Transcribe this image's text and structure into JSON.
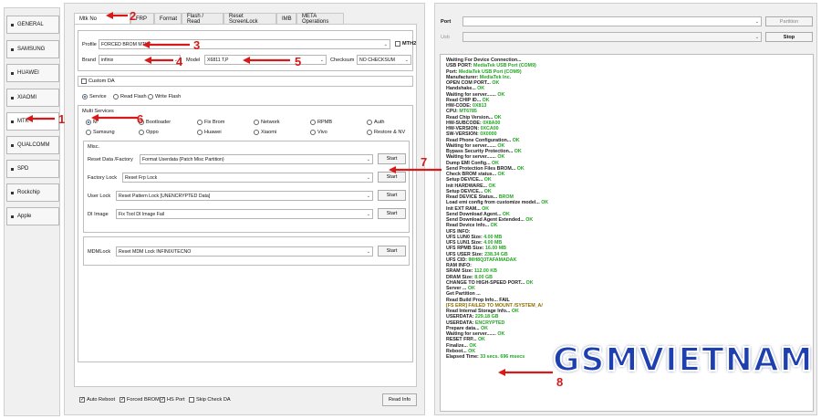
{
  "sidebar": {
    "items": [
      "GENERAL",
      "SAMSUNG",
      "HUAWEI",
      "XIAOMI",
      "MTK",
      "QUALCOMM",
      "SPD",
      "Rockchip",
      "Apple"
    ]
  },
  "tabs": [
    "Mtk No",
    "FRP",
    "Format",
    "Flash / Read",
    "Reset ScreenLock",
    "IMB",
    "META Operations"
  ],
  "top": {
    "profile_label": "Profile",
    "profile_value": "FORCED BROM MTH2",
    "mth2_label": "MTH2",
    "brand_label": "Brand",
    "brand_value": "infinix",
    "model_label": "Model",
    "model_value": "X6811 T,P",
    "checksum_label": "Checksum",
    "checksum_value": "NO CHECKSUM",
    "custom_da_label": "Custom DA"
  },
  "modes": [
    "Service",
    "Read Flash",
    "Write Flash"
  ],
  "multi_services": {
    "title": "Multi Services",
    "row1": [
      "M",
      "Bootloader",
      "Fix Brom",
      "Network",
      "RPMB",
      "Auth"
    ],
    "row2": [
      "Samsung",
      "Oppo",
      "Huawei",
      "Xiaomi",
      "Vivo",
      "Restore & NV"
    ]
  },
  "misc": {
    "title": "Misc.",
    "rows": [
      {
        "label": "Reset Data /Factory",
        "value": "Format Userdata (Patch Misc Partition)",
        "button": "Start"
      },
      {
        "label": "Factory Lock",
        "value": "Reset Frp Lock",
        "button": "Start"
      },
      {
        "label": "User Lock",
        "value": "Reset Pattern Lock [UNENCRYPTED Data]",
        "button": "Start"
      },
      {
        "label": "DI Image",
        "value": "Fix Tool DI Image Fail",
        "button": "Start"
      }
    ],
    "mdm_label": "MDMLock",
    "mdm_value": "Reset MDM Lock INFINIX/TECNO",
    "mdm_button": "Start"
  },
  "bottom": {
    "checks": [
      "Auto Reboot",
      "Forced BROM",
      "HS Port",
      "Skip Check DA"
    ],
    "read_info": "Read Info"
  },
  "right": {
    "port_label": "Port",
    "partition_button": "Partition",
    "usb_label": "Usb",
    "stop_button": "Stop"
  },
  "log": [
    {
      "k": "Waiting For Device Connection...",
      "v": ""
    },
    {
      "k": "USB PORT: ",
      "v": "MediaTek USB Port (COM9)"
    },
    {
      "k": "Port: ",
      "v": "MediaTek USB Port (COM9)"
    },
    {
      "k": "Manufacturer: ",
      "v": "MediaTek Inc."
    },
    {
      "k": "OPEN COM PORT... ",
      "v": "OK"
    },
    {
      "k": "Handshake... ",
      "v": "OK"
    },
    {
      "k": "Waiting for server....... ",
      "v": "OK"
    },
    {
      "k": "Read CHIP ID... ",
      "v": "OK"
    },
    {
      "k": "HW-CODE: ",
      "v": "0X813"
    },
    {
      "k": "CPU: ",
      "v": "MT6785"
    },
    {
      "k": "Read Chip Version... ",
      "v": "OK"
    },
    {
      "k": "HW-SUBCODE: ",
      "v": "0X8A00"
    },
    {
      "k": "HW-VERSION: ",
      "v": "0XCA00"
    },
    {
      "k": "SW-VERSION: ",
      "v": "0X0000"
    },
    {
      "k": "Read Phone Configuration... ",
      "v": "OK"
    },
    {
      "k": "Waiting for server....... ",
      "v": "OK"
    },
    {
      "k": "Bypass Security Protection... ",
      "v": "OK"
    },
    {
      "k": "Waiting for server....... ",
      "v": "OK"
    },
    {
      "k": "Dump EMI Config... ",
      "v": "OK"
    },
    {
      "k": "Send Protection Files BROM... ",
      "v": "OK"
    },
    {
      "k": "Check BROM status... ",
      "v": "OK"
    },
    {
      "k": "Setup DEVICE... ",
      "v": "OK"
    },
    {
      "k": "Init HARDWARE... ",
      "v": "OK"
    },
    {
      "k": "Setup DEVICE... ",
      "v": "OK"
    },
    {
      "k": "Read DEVICE Status... ",
      "v": "BROM"
    },
    {
      "k": "Load emi config from customize model... ",
      "v": "OK"
    },
    {
      "k": "Init EXT RAM... ",
      "v": "OK"
    },
    {
      "k": "Send Download Agent... ",
      "v": "OK"
    },
    {
      "k": "Send Download Agent Extended... ",
      "v": "OK"
    },
    {
      "k": "Read Device Info... ",
      "v": "OK"
    },
    {
      "k": "UFS INFO:",
      "v": ""
    },
    {
      "k": "UFS LUN0 Size: ",
      "v": "4.00 MB"
    },
    {
      "k": "UFS LUN1 Size: ",
      "v": "4.00 MB"
    },
    {
      "k": "UFS RPMB Size: ",
      "v": "16.00 MB"
    },
    {
      "k": "UFS USER Size: ",
      "v": "238.34 GB"
    },
    {
      "k": "UFS CID: ",
      "v": "IMH8Q3TAFAMADAK"
    },
    {
      "k": "RAM INFO:",
      "v": ""
    },
    {
      "k": "SRAM Size: ",
      "v": "112.00 KB"
    },
    {
      "k": "DRAM Size: ",
      "v": "8.00 GB"
    },
    {
      "k": "CHANGE TO HIGH-SPEED PORT... ",
      "v": "OK"
    },
    {
      "k": "Server ... ",
      "v": "OK"
    },
    {
      "k": "Get Partition ... ",
      "v": ""
    },
    {
      "k": "Read Build Prop Info... ",
      "v": "FAIL"
    },
    {
      "k": "   [FS ERR] FAILED TO MOUNT /SYSTEM_A/",
      "v": ""
    },
    {
      "k": "Read Internal Storage Info... ",
      "v": "OK"
    },
    {
      "k": "USERDATA: ",
      "v": "229.18 GB"
    },
    {
      "k": "USERDATA: ",
      "v": "ENCRYPTED"
    },
    {
      "k": "Prepare data... ",
      "v": "OK"
    },
    {
      "k": "Waiting for server....... ",
      "v": "OK"
    },
    {
      "k": "RESET FRP... ",
      "v": "OK"
    },
    {
      "k": "Finalize... ",
      "v": "OK"
    },
    {
      "k": "Reboot... ",
      "v": "OK"
    },
    {
      "k": "Elapsed Time: ",
      "v": "33 secs. 696 msecs"
    }
  ],
  "annotations": {
    "numbers": [
      "1",
      "2",
      "3",
      "4",
      "5",
      "6",
      "7",
      "8"
    ],
    "color": "#d61a1a"
  },
  "watermark": "GSMVIETNAM",
  "colors": {
    "log_value": "#1fa51f",
    "watermark": "#1e3fb0",
    "accent": "#1a5fb4"
  }
}
